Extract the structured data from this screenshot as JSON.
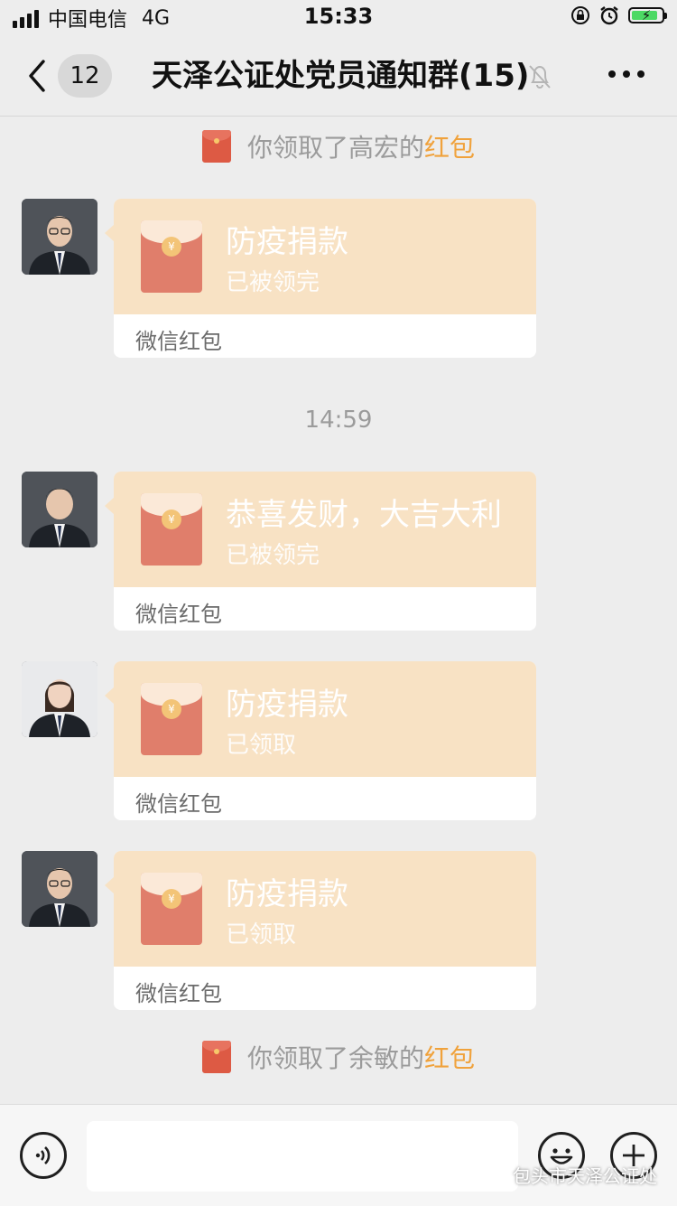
{
  "status_bar": {
    "carrier": "中国电信",
    "network": "4G",
    "time": "15:33"
  },
  "nav": {
    "unread_count": "12",
    "title": "天泽公证处党员通知群(15)"
  },
  "notices": [
    {
      "prefix": "你领取了高宏的",
      "highlight": "红包"
    },
    {
      "prefix": "你领取了余敏的",
      "highlight": "红包"
    }
  ],
  "timestamp": "14:59",
  "messages": [
    {
      "title": "防疫捐款",
      "status": "已被领完",
      "label": "微信红包"
    },
    {
      "title": "恭喜发财，大吉大利",
      "status": "已被领完",
      "label": "微信红包"
    },
    {
      "title": "防疫捐款",
      "status": "已领取",
      "label": "微信红包"
    },
    {
      "title": "防疫捐款",
      "status": "已领取",
      "label": "微信红包"
    }
  ],
  "watermark": "包头市天泽公证处",
  "colors": {
    "background": "#ededed",
    "card_top": "#f8e2c4",
    "envelope": "#e07e6b",
    "highlight": "#f0a23c"
  },
  "icons": [
    "signal-icon",
    "lock-rotation-icon",
    "alarm-icon",
    "battery-icon",
    "back-icon",
    "mute-bell-icon",
    "more-icon",
    "voice-icon",
    "emoji-icon",
    "plus-icon",
    "wechat-logo-icon"
  ]
}
